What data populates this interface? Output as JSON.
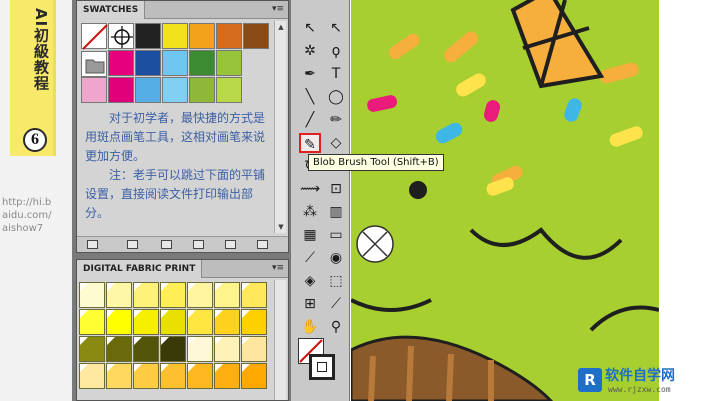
{
  "banner": {
    "title": "AI初級教程",
    "number": "6"
  },
  "watermark": {
    "url_lines": [
      "http://hi.b",
      "aidu.com/",
      "aishow7"
    ]
  },
  "swatches_panel": {
    "tab": "SWATCHES",
    "menu_icon": "panel-menu-icon",
    "colors_row1": [
      "#ffffff",
      "#e8e8e8",
      "#222222",
      "#f2e21a",
      "#f3a21b",
      "#d56b1c",
      "#8a4b16"
    ],
    "colors_row2": [
      "#ffffff",
      "#e6007e",
      "#1c4fa0",
      "#6fc6f0",
      "#3c8a32",
      "#97c43b"
    ],
    "colors_row3": [
      "#f0a6cc",
      "#e0007a",
      "#55aee6",
      "#7fd0f2",
      "#8fb83a",
      "#b8d84a"
    ],
    "tutorial_text": {
      "para1": "对于初学者，最快捷的方式是用斑点画笔工具，这相对画笔来说更加方便。",
      "para2": "注：老手可以跳过下面的平铺设置，直接阅读文件打印输出部分。"
    }
  },
  "fabric_panel": {
    "tab": "DIGITAL FABRIC PRINT",
    "rows": [
      [
        "#fffbd0",
        "#fff6a8",
        "#fff27a",
        "#ffee55",
        "#fff4a0",
        "#fff48c",
        "#ffe95a"
      ],
      [
        "#ffff33",
        "#ffff00",
        "#f6f000",
        "#e8e000",
        "#ffe640",
        "#ffd21e",
        "#ffd000"
      ],
      [
        "#8a8a12",
        "#6a6a0a",
        "#55550a",
        "#3a3a08",
        "#fff8d8",
        "#fff2b8",
        "#ffe6a0"
      ],
      [
        "#ffe8a0",
        "#ffd860",
        "#ffcc44",
        "#ffc030",
        "#ffb820",
        "#ffb010",
        "#ffa800"
      ]
    ]
  },
  "tools": {
    "tooltip": "Blob Brush Tool (Shift+B)",
    "items": [
      {
        "name": "selection-tool",
        "glyph": "↖"
      },
      {
        "name": "direct-selection-tool",
        "glyph": "↖"
      },
      {
        "name": "magic-wand-tool",
        "glyph": "✲"
      },
      {
        "name": "lasso-tool",
        "glyph": "ϙ"
      },
      {
        "name": "pen-tool",
        "glyph": "✒"
      },
      {
        "name": "type-tool",
        "glyph": "T"
      },
      {
        "name": "line-tool",
        "glyph": "╲"
      },
      {
        "name": "ellipse-tool",
        "glyph": "◯"
      },
      {
        "name": "paintbrush-tool",
        "glyph": "╱"
      },
      {
        "name": "pencil-tool",
        "glyph": "✏"
      },
      {
        "name": "blob-brush-tool",
        "glyph": "✎"
      },
      {
        "name": "eraser-tool",
        "glyph": "◇"
      },
      {
        "name": "rotate-tool",
        "glyph": "↻"
      },
      {
        "name": "scale-tool",
        "glyph": "⇲"
      },
      {
        "name": "width-tool",
        "glyph": "⟿"
      },
      {
        "name": "free-transform-tool",
        "glyph": "⊡"
      },
      {
        "name": "symbol-sprayer-tool",
        "glyph": "⁂"
      },
      {
        "name": "column-graph-tool",
        "glyph": "▥"
      },
      {
        "name": "mesh-tool",
        "glyph": "▦"
      },
      {
        "name": "gradient-tool",
        "glyph": "▭"
      },
      {
        "name": "eyedropper-tool",
        "glyph": "⟋"
      },
      {
        "name": "blend-tool",
        "glyph": "◉"
      },
      {
        "name": "live-paint-bucket-tool",
        "glyph": "◈"
      },
      {
        "name": "live-paint-selection-tool",
        "glyph": "⬚"
      },
      {
        "name": "artboard-tool",
        "glyph": "⊞"
      },
      {
        "name": "slice-tool",
        "glyph": "⟋"
      },
      {
        "name": "hand-tool",
        "glyph": "✋"
      },
      {
        "name": "zoom-tool",
        "glyph": "⚲"
      }
    ]
  },
  "logo": {
    "mark": "R",
    "title": "软件自学网",
    "url": "www.rjzxw.com"
  },
  "artwork": {
    "background": "#a7cf2f",
    "sprinkle_colors": [
      "#f6ae3c",
      "#ffe34d",
      "#ea1b7a",
      "#3fb7e6",
      "#2a2a2a"
    ]
  }
}
